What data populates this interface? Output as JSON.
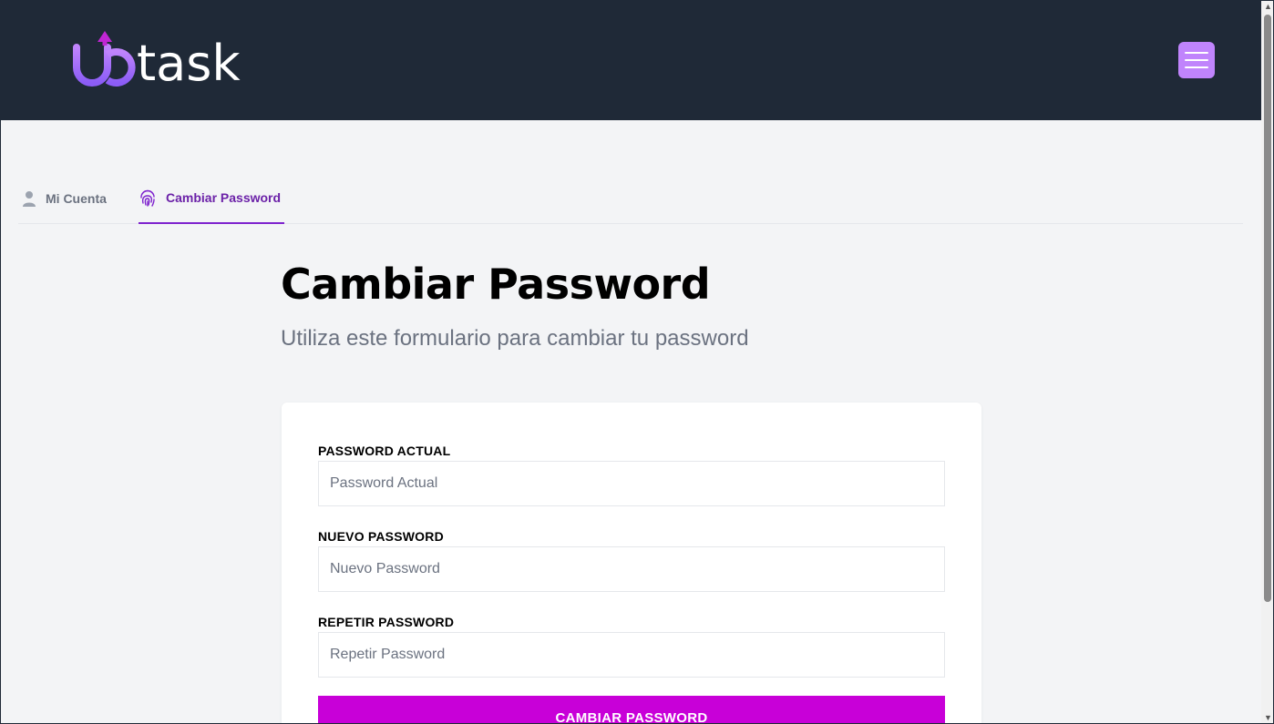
{
  "header": {
    "logo_text": "uptask",
    "menu_icon": "hamburger-icon"
  },
  "tabs": [
    {
      "label": "Mi Cuenta",
      "icon": "user-icon",
      "active": false
    },
    {
      "label": "Cambiar Password",
      "icon": "fingerprint-icon",
      "active": true
    }
  ],
  "page": {
    "title": "Cambiar Password",
    "subtitle": "Utiliza este formulario para cambiar tu password"
  },
  "form": {
    "fields": [
      {
        "label": "PASSWORD ACTUAL",
        "placeholder": "Password Actual",
        "value": ""
      },
      {
        "label": "NUEVO PASSWORD",
        "placeholder": "Nuevo Password",
        "value": ""
      },
      {
        "label": "REPETIR PASSWORD",
        "placeholder": "Repetir Password",
        "value": ""
      }
    ],
    "submit_label": "CAMBIAR PASSWORD"
  },
  "colors": {
    "header_bg": "#1f2937",
    "accent": "#c800d8",
    "menu_button": "#c084fc",
    "active_tab": "#6b21a8"
  }
}
